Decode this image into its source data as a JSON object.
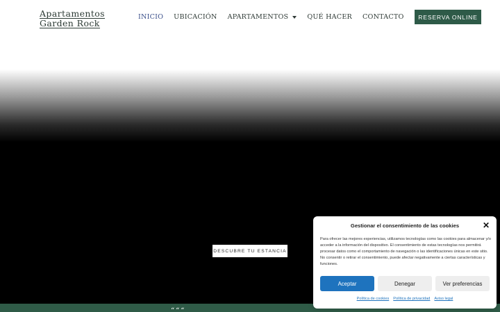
{
  "header": {
    "logo_line1": "Apartamentos",
    "logo_line2": "Garden Rock",
    "nav": [
      {
        "label": "INICIO",
        "active": true
      },
      {
        "label": "UBICACIÓN"
      },
      {
        "label": "APARTAMENTOS",
        "has_dropdown": true
      },
      {
        "label": "QUÉ HACER"
      },
      {
        "label": "CONTACTO"
      }
    ],
    "cta_label": "RESERVA ONLINE"
  },
  "hero": {
    "button_label": "DESCUBRE TU ESTANCIA"
  },
  "strip": {
    "mark_text": "“““"
  },
  "cookie": {
    "title": "Gestionar el consentimiento de las cookies",
    "close_icon": "close-icon",
    "body": "Para ofrecer las mejores experiencias, utilizamos tecnologías como las cookies para almacenar y/o acceder a la información del dispositivo. El consentimiento de estas tecnologías nos permitirá procesar datos como el comportamiento de navegación o las identificaciones únicas en este sitio. No consentir o retirar el consentimiento, puede afectar negativamente a ciertas características y funciones.",
    "accept_label": "Aceptar",
    "deny_label": "Denegar",
    "prefs_label": "Ver preferencias",
    "links": [
      "Política de cookies",
      "Política de privacidad",
      "Aviso legal"
    ]
  },
  "colors": {
    "brand_green": "#2e5a48",
    "accent_blue": "#1e73be",
    "nav_active": "#3a4f8a"
  }
}
